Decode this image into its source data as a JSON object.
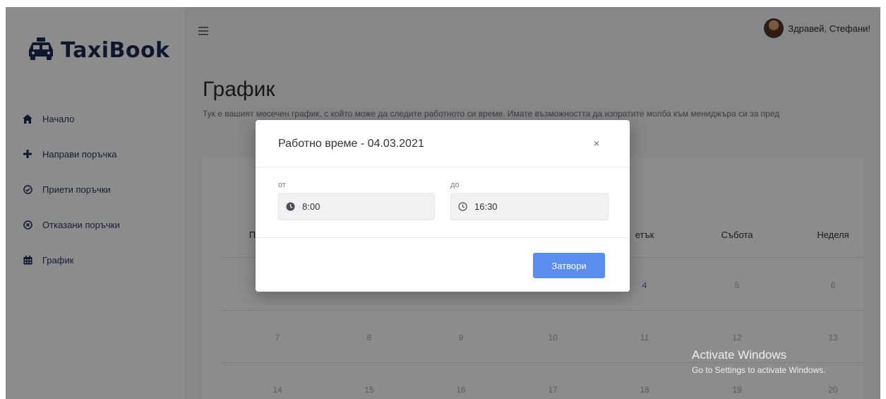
{
  "app": {
    "name": "TaxiBook"
  },
  "sidebar": {
    "items": [
      {
        "label": "Начало",
        "icon": "home-icon"
      },
      {
        "label": "Направи поръчка",
        "icon": "plus-icon"
      },
      {
        "label": "Приети поръчки",
        "icon": "check-circle-icon"
      },
      {
        "label": "Отказани поръчки",
        "icon": "x-circle-icon"
      },
      {
        "label": "График",
        "icon": "calendar-icon"
      }
    ]
  },
  "header": {
    "greeting": "Здравей, Стефани!"
  },
  "page": {
    "title": "График",
    "description": "Тук е вашият месечен график, с който може да следите работното си време. Имате възможността да изпратите молба към мениджъра си за пред"
  },
  "calendar": {
    "weekdays": [
      "По",
      "",
      "",
      "",
      "етък",
      "Събота",
      "Неделя"
    ],
    "weeks": [
      [
        "",
        "",
        "",
        "",
        "4",
        "5",
        "6"
      ],
      [
        "7",
        "8",
        "9",
        "10",
        "11",
        "12",
        "13"
      ],
      [
        "14",
        "15",
        "16",
        "17",
        "18",
        "19",
        "20"
      ]
    ]
  },
  "modal": {
    "title": "Работно време - 04.03.2021",
    "from_label": "от",
    "from_value": "8:00",
    "to_label": "до",
    "to_value": "16:30",
    "close_button": "Затвори"
  },
  "watermark": {
    "title": "Activate Windows",
    "subtitle": "Go to Settings to activate Windows."
  },
  "colors": {
    "brand": "#1d2b56",
    "accent": "#5b8def",
    "active_day": "#3b6fd8"
  }
}
